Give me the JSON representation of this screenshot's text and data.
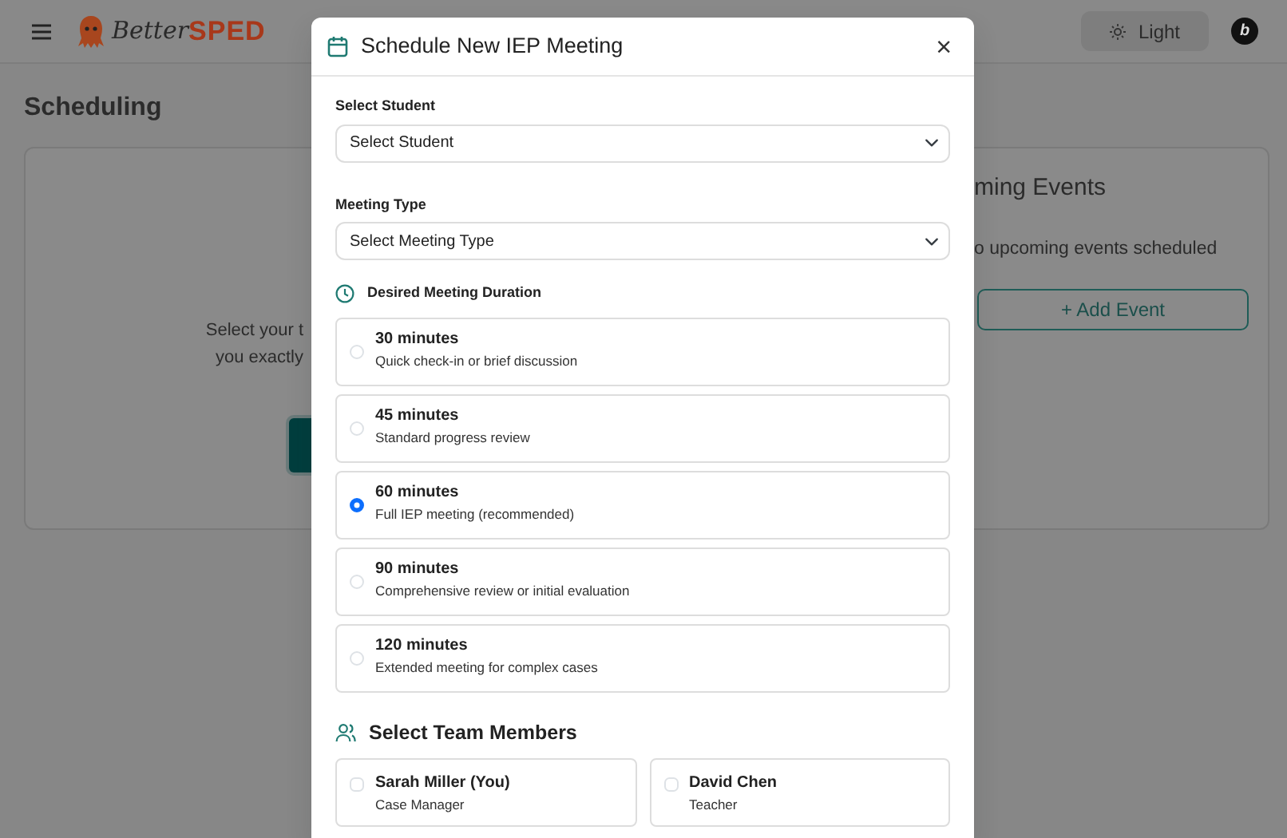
{
  "navbar": {
    "logo": {
      "script": "Better",
      "bold": "SPED"
    },
    "theme_button": "Light",
    "avatar": "b"
  },
  "page": {
    "title": "Scheduling",
    "main_card": {
      "lines": [
        "Select your t",
        "you exactly"
      ]
    },
    "events_card": {
      "title": "ming Events",
      "empty_text": "o upcoming events scheduled",
      "add_button": "+ Add Event"
    }
  },
  "modal": {
    "title": "Schedule New IEP Meeting",
    "close": "×",
    "student": {
      "label": "Select Student",
      "value": "Select Student"
    },
    "meeting_type": {
      "label": "Meeting Type",
      "value": "Select Meeting Type"
    },
    "duration": {
      "label": "Desired Meeting Duration",
      "options": [
        {
          "title": "30 minutes",
          "description": "Quick check-in or brief discussion",
          "selected": false
        },
        {
          "title": "45 minutes",
          "description": "Standard progress review",
          "selected": false
        },
        {
          "title": "60 minutes",
          "description": "Full IEP meeting (recommended)",
          "selected": true
        },
        {
          "title": "90 minutes",
          "description": "Comprehensive review or initial evaluation",
          "selected": false
        },
        {
          "title": "120 minutes",
          "description": "Extended meeting for complex cases",
          "selected": false
        }
      ]
    },
    "team": {
      "title": "Select Team Members",
      "members": [
        {
          "name": "Sarah Miller (You)",
          "role": "Case Manager",
          "checked": false
        },
        {
          "name": "David Chen",
          "role": "Teacher",
          "checked": false
        }
      ]
    }
  }
}
